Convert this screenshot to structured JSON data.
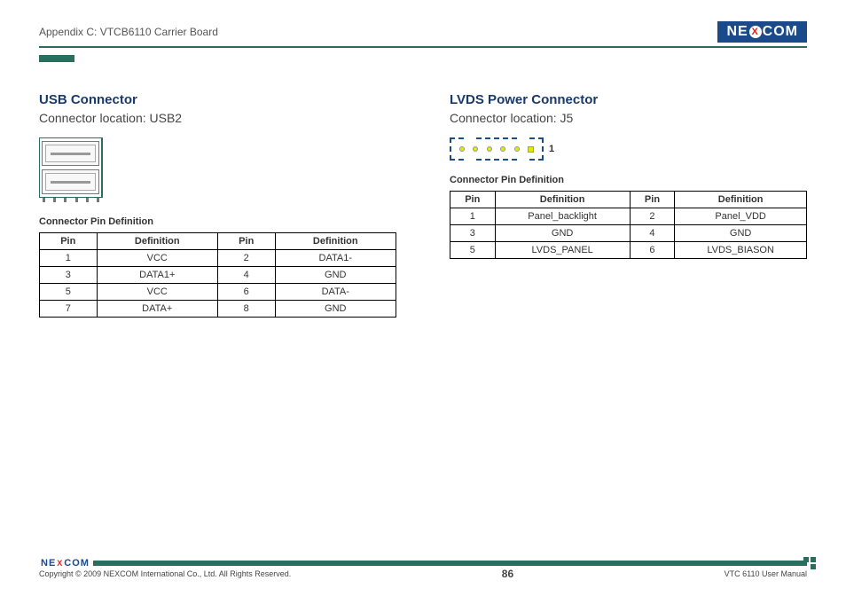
{
  "header": {
    "title": "Appendix C: VTCB6110 Carrier Board",
    "brand_left": "NE",
    "brand_mid": "X",
    "brand_right": "COM"
  },
  "left": {
    "title": "USB Connector",
    "subtitle": "Connector location: USB2",
    "pin_def_title": "Connector Pin Definition",
    "headers": {
      "pin": "Pin",
      "def": "Definition"
    },
    "rows": [
      {
        "p1": "1",
        "d1": "VCC",
        "p2": "2",
        "d2": "DATA1-"
      },
      {
        "p1": "3",
        "d1": "DATA1+",
        "p2": "4",
        "d2": "GND"
      },
      {
        "p1": "5",
        "d1": "VCC",
        "p2": "6",
        "d2": "DATA-"
      },
      {
        "p1": "7",
        "d1": "DATA+",
        "p2": "8",
        "d2": "GND"
      }
    ]
  },
  "right": {
    "title": "LVDS Power Connector",
    "subtitle": "Connector location: J5",
    "pin1_label": "1",
    "pin_def_title": "Connector Pin Definition",
    "headers": {
      "pin": "Pin",
      "def": "Definition"
    },
    "rows": [
      {
        "p1": "1",
        "d1": "Panel_backlight",
        "p2": "2",
        "d2": "Panel_VDD"
      },
      {
        "p1": "3",
        "d1": "GND",
        "p2": "4",
        "d2": "GND"
      },
      {
        "p1": "5",
        "d1": "LVDS_PANEL",
        "p2": "6",
        "d2": "LVDS_BIASON"
      }
    ]
  },
  "footer": {
    "copyright": "Copyright © 2009 NEXCOM International Co., Ltd. All Rights Reserved.",
    "page": "86",
    "manual": "VTC 6110 User Manual"
  }
}
